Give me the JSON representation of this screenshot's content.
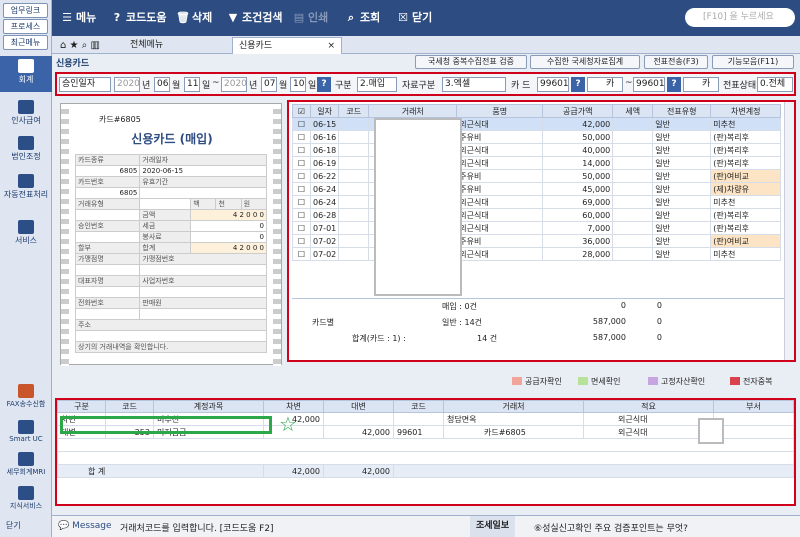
{
  "sidebar": {
    "top_buttons": [
      "업무링크",
      "프로세스",
      "최근메뉴"
    ],
    "items": [
      "회계",
      "인사급여",
      "법인조정",
      "자동전표처리",
      "서비스"
    ],
    "bottom_items": [
      "FAX송수신함",
      "Smart UC",
      "세무회계MRI",
      "지식서비스"
    ],
    "close": "닫기"
  },
  "toolbar": {
    "menu": "메뉴",
    "code_help": "코드도움",
    "delete": "삭제",
    "cond_search": "조건검색",
    "print": "인쇄",
    "query": "조회",
    "close": "닫기",
    "search_placeholder": "[F10] 을 누르세요"
  },
  "tabs": {
    "all": "전체메뉴",
    "current": "신용카드"
  },
  "page": {
    "title": "신용카드",
    "buttons": [
      "국세청 중복수집전표 검증",
      "수집한 국세청자료집계",
      "전표전송(F3)",
      "기능모음(F11)"
    ]
  },
  "filter": {
    "date_type": "승인일자",
    "from_year": "2020",
    "from_month": "06",
    "from_day": "11",
    "to_year": "2020",
    "to_month": "07",
    "to_day": "10",
    "year_lbl": "년",
    "month_lbl": "월",
    "day_lbl": "일",
    "tilde": "~",
    "gubun_lbl": "구분",
    "gubun": "2.매입",
    "data_lbl": "자료구분",
    "data": "3.엑셀",
    "card_lbl": "카 드",
    "card_from": "99601",
    "card_to": "99601",
    "card_txt": "카",
    "status_lbl": "전표상태",
    "status": "0.전체"
  },
  "card": {
    "number": "카드#6805",
    "title": "신용카드 (매입)",
    "labels": {
      "kind": "카드종류",
      "date_l": "거래일자",
      "date": "2020-06-15",
      "card_no": "카드번호",
      "valid": "유효기간",
      "suffix": "6805",
      "suffix2": "6805",
      "txn_type": "거래유형",
      "appr": "승인번호",
      "installment": "할부",
      "amount": "금액",
      "tax": "세금",
      "service": "봉사료",
      "total": "합계",
      "amount_v": "4 2 0 0 0",
      "zero": "0",
      "total_v": "4 2 0 0 0",
      "merchant": "가맹점명",
      "merchant_no": "가맹점번호",
      "rep": "대표자명",
      "bizno": "사업자번호",
      "phone": "전화번호",
      "seller": "판매원",
      "addr": "주소",
      "confirm": "상기의 거래내역을 확인합니다.",
      "cols": [
        "백",
        "천",
        "원"
      ]
    }
  },
  "grid": {
    "headers": [
      "일자",
      "코드",
      "거래처",
      "품명",
      "공급가액",
      "세액",
      "전표유형",
      "차변계정"
    ],
    "rows": [
      [
        "06-15",
        "외근식대",
        "42,000",
        "일반",
        "미추천"
      ],
      [
        "06-16",
        "주유비",
        "50,000",
        "일반",
        "(판)복리후"
      ],
      [
        "06-18",
        "외근식대",
        "40,000",
        "일반",
        "(판)복리후"
      ],
      [
        "06-19",
        "외근식대",
        "14,000",
        "일반",
        "(판)복리후"
      ],
      [
        "06-22",
        "주유비",
        "50,000",
        "일반",
        "(판)여비교"
      ],
      [
        "06-24",
        "주유비",
        "45,000",
        "일반",
        "(제)차량유"
      ],
      [
        "06-24",
        "외근식대",
        "69,000",
        "일반",
        "미추천"
      ],
      [
        "06-28",
        "외근식대",
        "60,000",
        "일반",
        "(판)복리후"
      ],
      [
        "07-01",
        "외근식대",
        "7,000",
        "일반",
        "(판)복리후"
      ],
      [
        "07-02",
        "주유비",
        "36,000",
        "일반",
        "(판)여비교"
      ],
      [
        "07-02",
        "외근식대",
        "28,000",
        "일반",
        "미추천"
      ]
    ],
    "summary": {
      "by_card": "카드별",
      "buy_lbl": "매입 : 0건",
      "buy_amt": "0",
      "buy_tax": "0",
      "gen_lbl": "일반 : 14건",
      "gen_amt": "587,000",
      "gen_tax": "0",
      "tot_lbl": "합계(카드 : 1) :",
      "tot_cnt": "14 건",
      "tot_amt": "587,000",
      "tot_tax": "0"
    }
  },
  "legend": [
    "공급자확인",
    "면세확인",
    "고정자산확인",
    "전자중복"
  ],
  "lower": {
    "headers": [
      "구분",
      "코드",
      "계정과목",
      "차변",
      "대변",
      "코드",
      "거래처",
      "적요",
      "부서"
    ],
    "rows": [
      [
        "차변",
        "",
        "미추천",
        "42,000",
        "",
        "",
        "청담면옥",
        "외근식대"
      ],
      [
        "대변",
        "253",
        "미지급금",
        "",
        "42,000",
        "99601",
        "카드#6805",
        "외근식대"
      ]
    ],
    "total_lbl": "합    계",
    "total_dr": "42,000",
    "total_cr": "42,000"
  },
  "status": {
    "message": "Message",
    "msg_text": "거래처코드를 입력합니다. [코드도움 F2]",
    "info": "조세일보",
    "tip": "⑥성실신고확인 주요 검증포인트는 무엇?"
  },
  "colors": {
    "red": "#d0021b",
    "navy": "#2d4c82",
    "green": "#2aa84a"
  }
}
